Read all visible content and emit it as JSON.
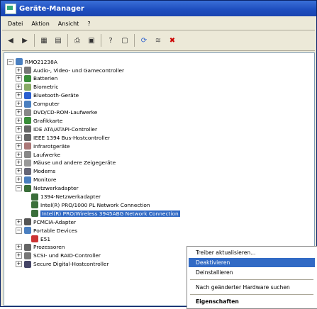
{
  "window": {
    "title": "Geräte-Manager"
  },
  "menu": [
    "Datei",
    "Aktion",
    "Ansicht",
    "?"
  ],
  "toolbar": [
    "back-icon",
    "forward-icon",
    "sep",
    "view-icon",
    "properties-icon",
    "sep",
    "print-icon",
    "refresh-icon",
    "sep",
    "help-icon",
    "computer-icon",
    "sep",
    "scan-icon",
    "uninstall-icon",
    "disable-icon"
  ],
  "tree": {
    "root": "RMO21238A",
    "items": [
      {
        "label": "Audio-, Video- und Gamecontroller",
        "color": "#777"
      },
      {
        "label": "Batterien",
        "color": "#3a8e3a"
      },
      {
        "label": "Biometric",
        "color": "#8a6"
      },
      {
        "label": "Bluetooth-Geräte",
        "color": "#2a5fd0"
      },
      {
        "label": "Computer",
        "color": "#4a7fc0"
      },
      {
        "label": "DVD/CD-ROM-Laufwerke",
        "color": "#888"
      },
      {
        "label": "Grafikkarte",
        "color": "#3a8e3a"
      },
      {
        "label": "IDE ATA/ATAPI-Controller",
        "color": "#666"
      },
      {
        "label": "IEEE 1394 Bus-Hostcontroller",
        "color": "#666"
      },
      {
        "label": "Infrarotgeräte",
        "color": "#a77"
      },
      {
        "label": "Laufwerke",
        "color": "#888"
      },
      {
        "label": "Mäuse und andere Zeigegeräte",
        "color": "#999"
      },
      {
        "label": "Modems",
        "color": "#667"
      },
      {
        "label": "Monitore",
        "color": "#4a7fc0"
      },
      {
        "label": "Netzwerkadapter",
        "color": "#3a6e3a"
      },
      {
        "label": "PCMCIA-Adapter",
        "color": "#555"
      },
      {
        "label": "Portable Devices",
        "color": "#4a7fc0"
      },
      {
        "label": "Prozessoren",
        "color": "#666"
      },
      {
        "label": "SCSI- und RAID-Controller",
        "color": "#777"
      },
      {
        "label": "Secure Digital-Hostcontroller",
        "color": "#446"
      }
    ],
    "network_children": [
      "1394-Netzwerkadapter",
      "Intel(R) PRO/1000 PL Network Connection",
      "Intel(R) PRO/Wireless 3945ABG Network Connection"
    ],
    "portable_children": [
      "E51"
    ]
  },
  "context_menu": {
    "items": [
      "Treiber aktualisieren...",
      "Deaktivieren",
      "Deinstallieren",
      "Nach geänderter Hardware suchen",
      "Eigenschaften"
    ]
  }
}
